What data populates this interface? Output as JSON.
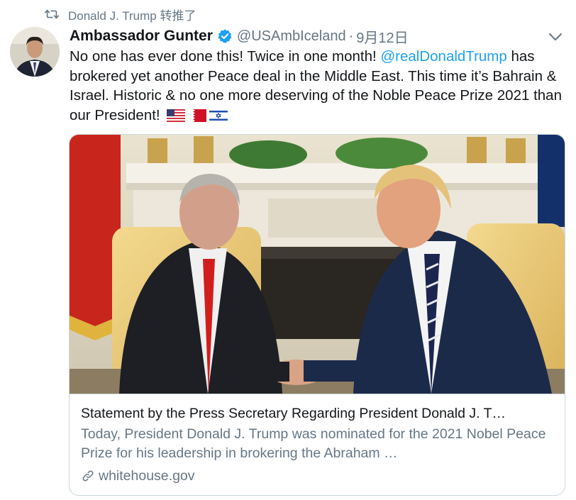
{
  "retweet": {
    "icon": "retweet-icon",
    "text": "Donald J. Trump 转推了"
  },
  "tweet": {
    "author_name": "Ambassador Gunter",
    "verified": true,
    "handle": "@USAmbIceland",
    "separator": "·",
    "date": "9月12日",
    "text_part1": "No one has ever done this! Twice in one month! ",
    "mention": "@realDonaldTrump",
    "text_part2": " has brokered yet another Peace deal in the Middle East. This time it’s Bahrain & Israel. Historic & no one more deserving of the Noble Peace Prize 2021 than our President!",
    "flags": [
      "us-flag",
      "bahrain-flag",
      "israel-flag"
    ]
  },
  "card": {
    "title": "Statement by the Press Secretary Regarding President Donald J. T…",
    "description": "Today, President Donald J. Trump was nominated for the 2021 Nobel Peace Prize for his leadership in brokering the Abraham …",
    "link_icon": "link-icon",
    "domain": "whitehouse.gov"
  },
  "colors": {
    "accent": "#1da1f2",
    "secondary_text": "#657786",
    "primary_text": "#14171a",
    "border": "#ccd6dd"
  }
}
